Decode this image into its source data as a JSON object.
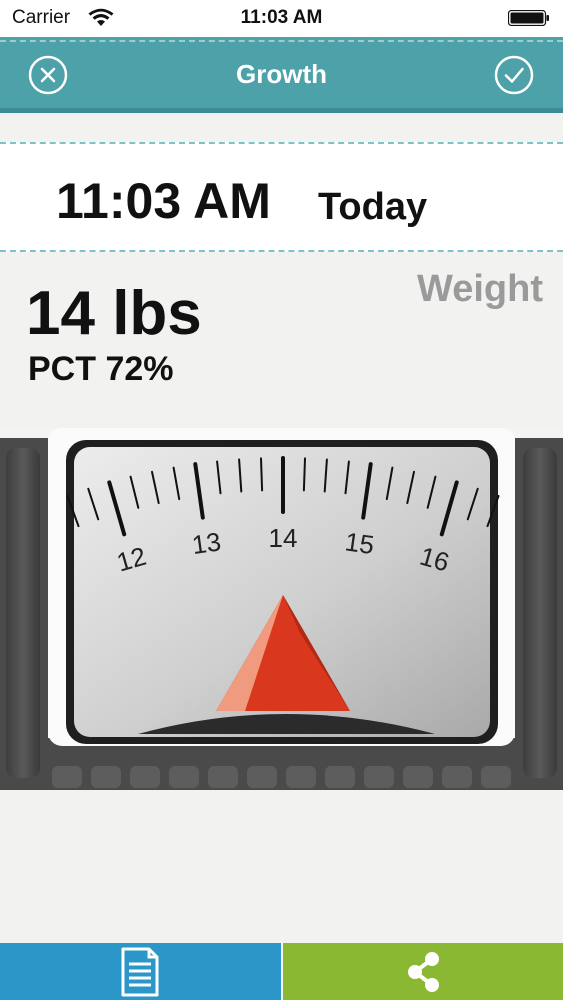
{
  "status_bar": {
    "carrier": "Carrier",
    "time": "11:03 AM"
  },
  "nav": {
    "title": "Growth",
    "cancel_icon": "close-icon",
    "confirm_icon": "checkmark-icon"
  },
  "entry": {
    "time": "11:03 AM",
    "date": "Today"
  },
  "measurement": {
    "weight": "14 lbs",
    "percentile": "PCT 72%",
    "label": "Weight"
  },
  "scale": {
    "ticks": [
      "12",
      "13",
      "14",
      "15",
      "16"
    ],
    "current_value": 14
  },
  "tabs": {
    "left_icon": "document-icon",
    "right_icon": "share-icon"
  },
  "colors": {
    "nav": "#4da1a9",
    "tab_left": "#2a97c8",
    "tab_right": "#8ab832",
    "needle": "#d9381e"
  }
}
